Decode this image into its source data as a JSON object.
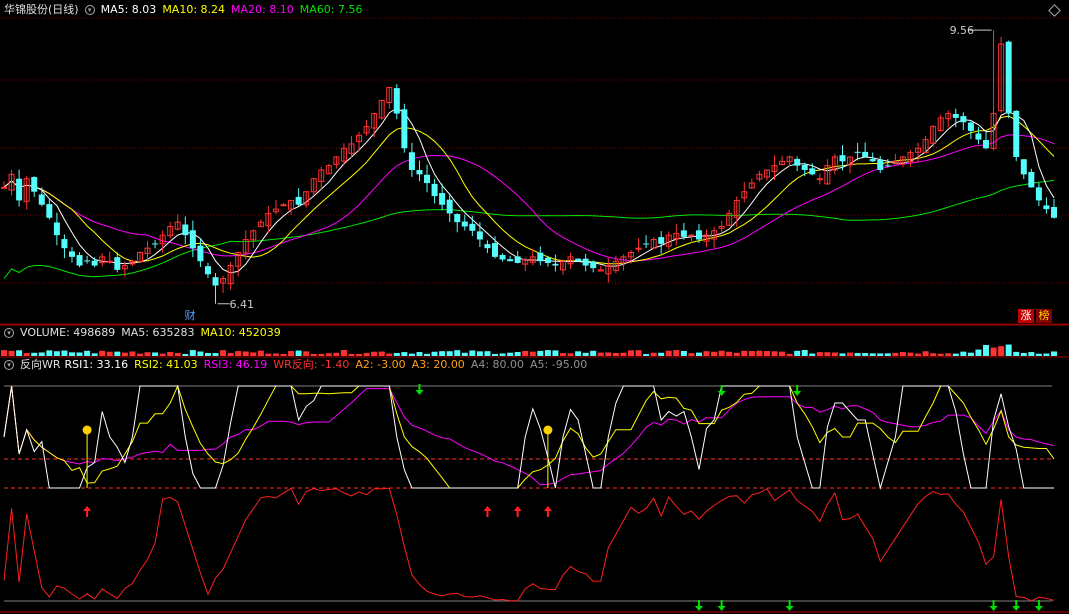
{
  "header": {
    "stock_name": "华锦股份(日线)",
    "ma5": "MA5: 8.03",
    "ma10": "MA10: 8.24",
    "ma20": "MA20: 8.10",
    "ma60": "MA60: 7.56"
  },
  "volume_header": {
    "label": "VOLUME: 498689",
    "ma5": "MA5: 635283",
    "ma10": "MA10: 452039"
  },
  "indicator_header": {
    "name": "反向WR",
    "rsi1": "RSI1: 33.16",
    "rsi2": "RSI2: 41.03",
    "rsi3": "RSI3: 46.19",
    "wr": "WR反向: -1.40",
    "a2": "A2: -3.00",
    "a3": "A3: 20.00",
    "a4": "A4: 80.00",
    "a5": "A5: -95.00"
  },
  "price_labels": {
    "high": "9.56",
    "low": "6.41"
  },
  "badges": {
    "cai": "财",
    "zhang": "涨",
    "bang": "榜"
  },
  "colors": {
    "up": "#ff3232",
    "down": "#54fcfc",
    "ma5": "#ffffff",
    "ma10": "#ffff00",
    "ma20": "#ff00ff",
    "ma60": "#00e600",
    "wr": "#ff2020",
    "grid": "#8c0000",
    "axis": "#a00000"
  },
  "chart_data": {
    "type": "candlestick",
    "ylim": [
      6.2,
      9.7
    ],
    "candle_count": 140,
    "extremes": {
      "high": 9.56,
      "low": 6.41
    },
    "ma_series": [
      {
        "name": "MA5",
        "color": "#ffffff"
      },
      {
        "name": "MA10",
        "color": "#ffff00"
      },
      {
        "name": "MA20",
        "color": "#ff00ff"
      },
      {
        "name": "MA60",
        "color": "#00e600"
      }
    ],
    "indicator_levels": {
      "a4": 80,
      "a3": 20,
      "a2": -3,
      "a5": -95
    }
  }
}
